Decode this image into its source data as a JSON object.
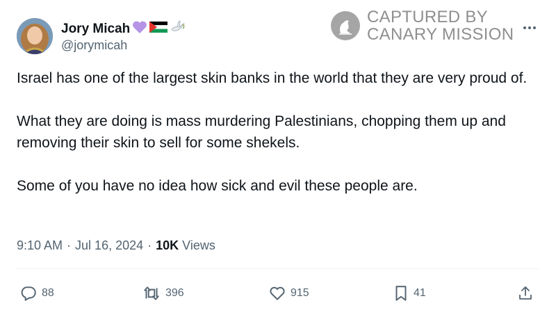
{
  "author": {
    "display_name": "Jory Micah",
    "handle": "@jorymicah",
    "name_emojis": [
      "purple-heart",
      "palestine-flag",
      "dove"
    ]
  },
  "watermark": {
    "line1": "CAPTURED BY",
    "line2": "CANARY MISSION"
  },
  "tweet": {
    "paragraphs": [
      "Israel has one of the largest skin banks in the world that they are very proud of.",
      "What they are doing is mass murdering Palestinians, chopping them up and removing their skin to sell for some shekels.",
      "Some of you have no idea how sick and evil these people are."
    ],
    "time": "9:10 AM",
    "date": "Jul 16, 2024",
    "views_count": "10K",
    "views_label": "Views",
    "separator": "·"
  },
  "actions": {
    "replies": "88",
    "reposts": "396",
    "likes": "915",
    "bookmarks": "41"
  },
  "colors": {
    "text": "#0f1419",
    "secondary": "#536471",
    "watermark": "#8f8f8f"
  }
}
